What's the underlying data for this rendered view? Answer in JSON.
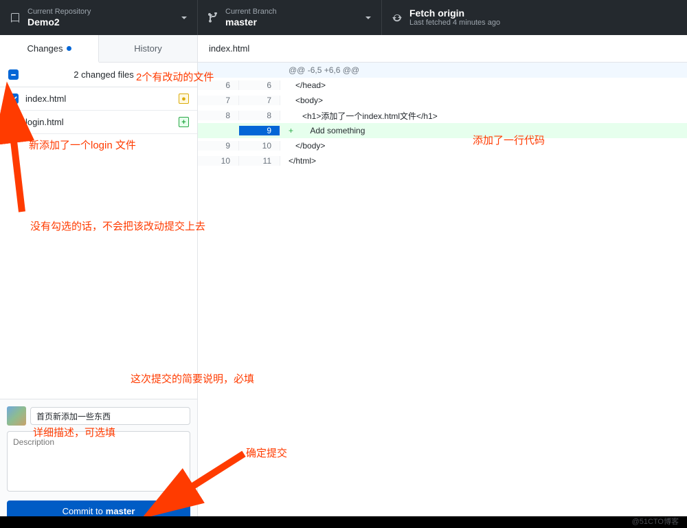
{
  "top": {
    "repo_label": "Current Repository",
    "repo_name": "Demo2",
    "branch_label": "Current Branch",
    "branch_name": "master",
    "fetch_title": "Fetch origin",
    "fetch_sub": "Last fetched 4 minutes ago"
  },
  "tabs": {
    "changes": "Changes",
    "history": "History"
  },
  "changed_count": "2 changed files",
  "files": {
    "0": {
      "name": "index.html",
      "checked": true,
      "status": "●"
    },
    "1": {
      "name": "login.html",
      "checked": false,
      "status": "+"
    }
  },
  "diff": {
    "filename": "index.html",
    "hunk": "@@ -6,5 +6,6 @@",
    "lines": {
      "0": {
        "old": "6",
        "new": "6",
        "code": "   </head>"
      },
      "1": {
        "old": "7",
        "new": "7",
        "code": "   <body>"
      },
      "2": {
        "old": "8",
        "new": "8",
        "code": "      <h1>添加了一个index.html文件</h1>"
      },
      "3": {
        "old": "",
        "new": "9",
        "code": "      Add something",
        "added": true
      },
      "4": {
        "old": "9",
        "new": "10",
        "code": "   </body>"
      },
      "5": {
        "old": "10",
        "new": "11",
        "code": "</html>"
      }
    }
  },
  "commit": {
    "summary_value": "首页新添加一些东西",
    "description_placeholder": "Description",
    "button_prefix": "Commit to ",
    "button_branch": "master"
  },
  "annotations": {
    "a1": "2个有改动的文件",
    "a2": "新添加了一个login 文件",
    "a3": "没有勾选的话，不会把该改动提交上去",
    "a4": "这次提交的简要说明，必填",
    "a5": "详细描述，可选填",
    "a6": "确定提交",
    "a7": "添加了一行代码"
  },
  "watermark": "@51CTO博客"
}
